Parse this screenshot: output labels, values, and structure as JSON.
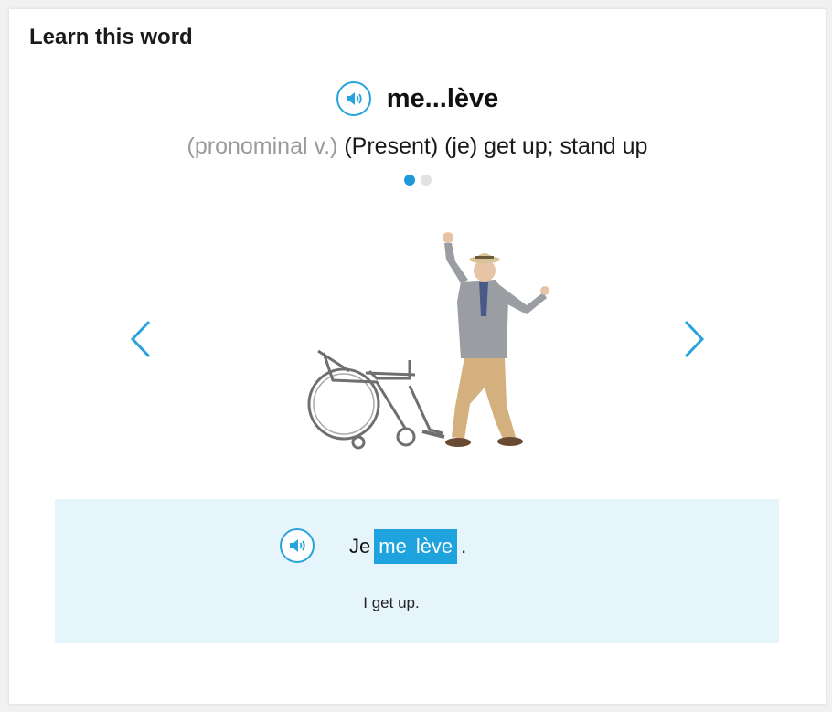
{
  "card": {
    "title": "Learn this word"
  },
  "word": {
    "text": "me...lève",
    "speaker_icon": "speaker-icon"
  },
  "definition": {
    "part_of_speech": "(pronominal v.)",
    "meaning": "(Present) (je) get up; stand up"
  },
  "carousel": {
    "total_slides": 2,
    "active_slide": 1,
    "prev_icon": "chevron-left-icon",
    "next_icon": "chevron-right-icon"
  },
  "example": {
    "before": "Je",
    "highlight_words": [
      "me",
      "lève"
    ],
    "after": ".",
    "translation": "I get up."
  },
  "colors": {
    "accent": "#29a3dd",
    "highlight_bg": "#1ea3df",
    "example_bg": "#e6f5fc",
    "pos_gray": "#9a9a9a"
  }
}
